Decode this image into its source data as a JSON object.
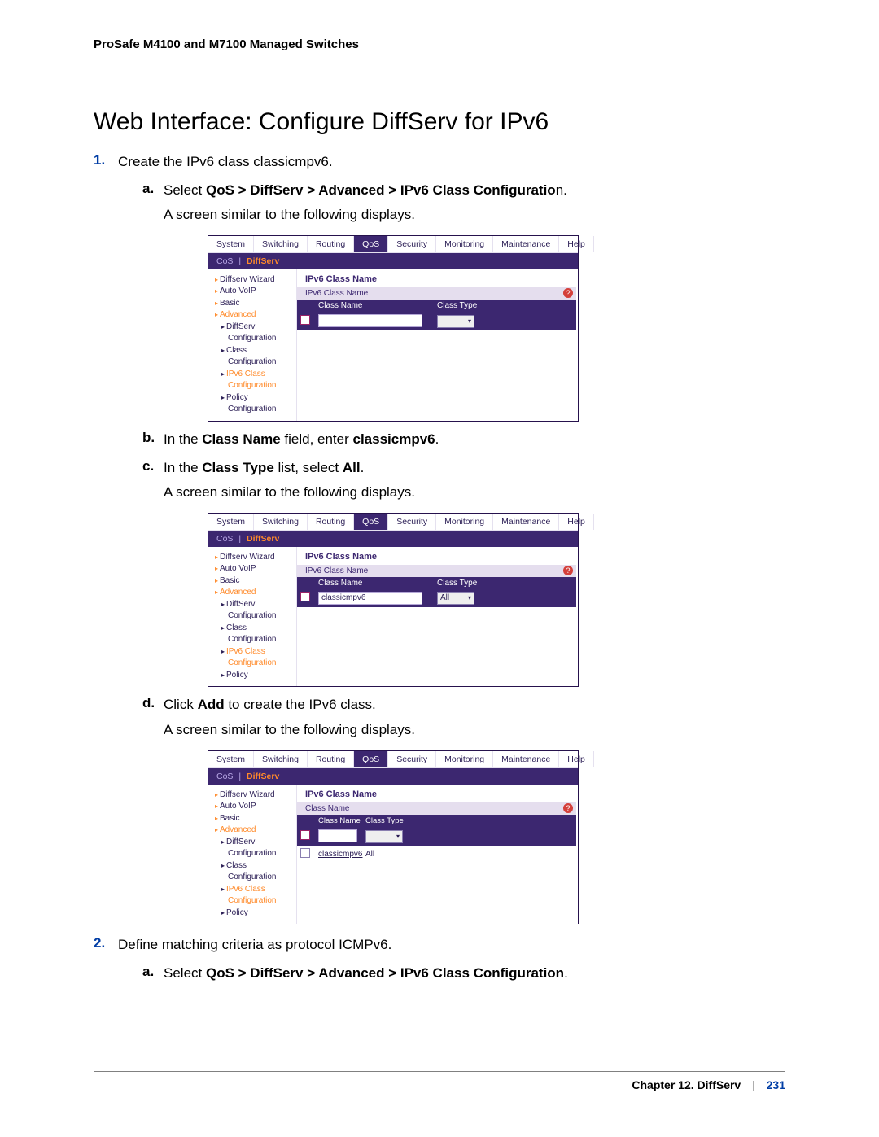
{
  "header": {
    "running": "ProSafe M4100 and M7100 Managed Switches"
  },
  "title": "Web Interface: Configure DiffServ for IPv6",
  "steps": {
    "s1": {
      "num": "1.",
      "text": "Create the IPv6 class classicmpv6.",
      "a": {
        "num": "a.",
        "lead": "Select ",
        "bold": "QoS > DiffServ > Advanced > IPv6 Class Configuratio",
        "tail": "n.",
        "after": "A screen similar to the following displays."
      },
      "b": {
        "num": "b.",
        "t1": "In the ",
        "b1": "Class Name",
        "t2": " field, enter ",
        "b2": "classicmpv6",
        "t3": "."
      },
      "c": {
        "num": "c.",
        "t1": "In the ",
        "b1": "Class Type",
        "t2": " list, select ",
        "b2": "All",
        "t3": ".",
        "after": "A screen similar to the following displays."
      },
      "d": {
        "num": "d.",
        "t1": "Click ",
        "b1": "Add",
        "t2": " to create the IPv6 class.",
        "after": "A screen similar to the following displays."
      }
    },
    "s2": {
      "num": "2.",
      "text": "Define matching criteria as protocol ICMPv6.",
      "a": {
        "num": "a.",
        "lead": "Select ",
        "bold": "QoS > DiffServ > Advanced > IPv6 Class Configuration",
        "tail": "."
      }
    }
  },
  "ui": {
    "tabs": {
      "system": "System",
      "switching": "Switching",
      "routing": "Routing",
      "qos": "QoS",
      "security": "Security",
      "monitoring": "Monitoring",
      "maintenance": "Maintenance",
      "help": "Help"
    },
    "subtabs": {
      "cos": "CoS",
      "diffserv": "DiffServ"
    },
    "side": {
      "wizard": "Diffserv Wizard",
      "autovoip": "Auto VoIP",
      "basic": "Basic",
      "advanced": "Advanced",
      "diffserv": "DiffServ",
      "configuration": "Configuration",
      "class": "Class",
      "ipv6class": "IPv6 Class",
      "ipv6class_conf": "Configuration",
      "policy": "Policy",
      "policy_conf": "Configuration"
    },
    "panel": {
      "title": "IPv6 Class Name",
      "header1": "IPv6 Class Name",
      "header2": "Class Name",
      "col_name": "Class Name",
      "col_type": "Class Type",
      "val_name_empty": "",
      "val_name_filled": "classicmpv6",
      "val_type_all": "All"
    },
    "help_icon": "?"
  },
  "footer": {
    "chapter": "Chapter 12.  DiffServ",
    "page": "231"
  }
}
